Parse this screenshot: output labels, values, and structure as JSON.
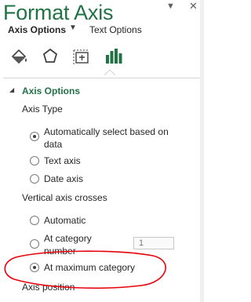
{
  "pane": {
    "title": "Format Axis",
    "dropdown_icon": "chevron-down-icon",
    "close_icon": "close-icon"
  },
  "tabs": {
    "axis_options": "Axis Options",
    "text_options": "Text Options"
  },
  "icons": [
    "fill-line-icon",
    "effects-icon",
    "size-properties-icon",
    "axis-options-icon"
  ],
  "section": {
    "title": "Axis Options"
  },
  "axis_type": {
    "heading": "Axis Type",
    "options": [
      {
        "label_line1": "Automatically select based on",
        "label_line2": "data",
        "checked": true
      },
      {
        "label": "Text axis",
        "checked": false
      },
      {
        "label": "Date axis",
        "checked": false
      }
    ]
  },
  "vertical_axis_crosses": {
    "heading": "Vertical axis crosses",
    "options": [
      {
        "label": "Automatic",
        "checked": false
      },
      {
        "label_line1": "At category",
        "label_line2": "number",
        "checked": false,
        "value": "1"
      },
      {
        "label": "At maximum category",
        "checked": true
      }
    ]
  },
  "axis_position": {
    "heading": "Axis position"
  },
  "colors": {
    "accent": "#217346",
    "annotation": "#e8000b"
  }
}
